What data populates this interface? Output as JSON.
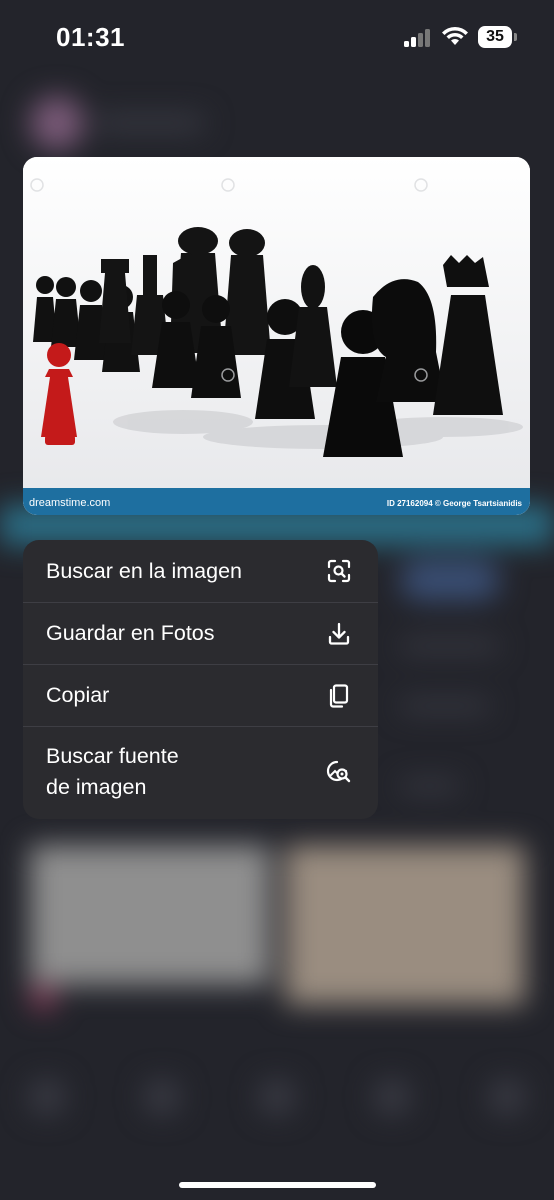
{
  "status_bar": {
    "time": "01:31",
    "battery": "35"
  },
  "preview": {
    "watermark_brand": "dreamstime.com",
    "watermark_id": "ID 27162094 © George Tsartsianidis"
  },
  "menu": {
    "items": [
      {
        "label": "Buscar en la imagen",
        "icon": "camera-search-icon"
      },
      {
        "label": "Guardar en Fotos",
        "icon": "download-icon"
      },
      {
        "label": "Copiar",
        "icon": "copy-icon"
      },
      {
        "label": "Buscar fuente\nde imagen",
        "icon": "image-search-icon"
      }
    ]
  }
}
